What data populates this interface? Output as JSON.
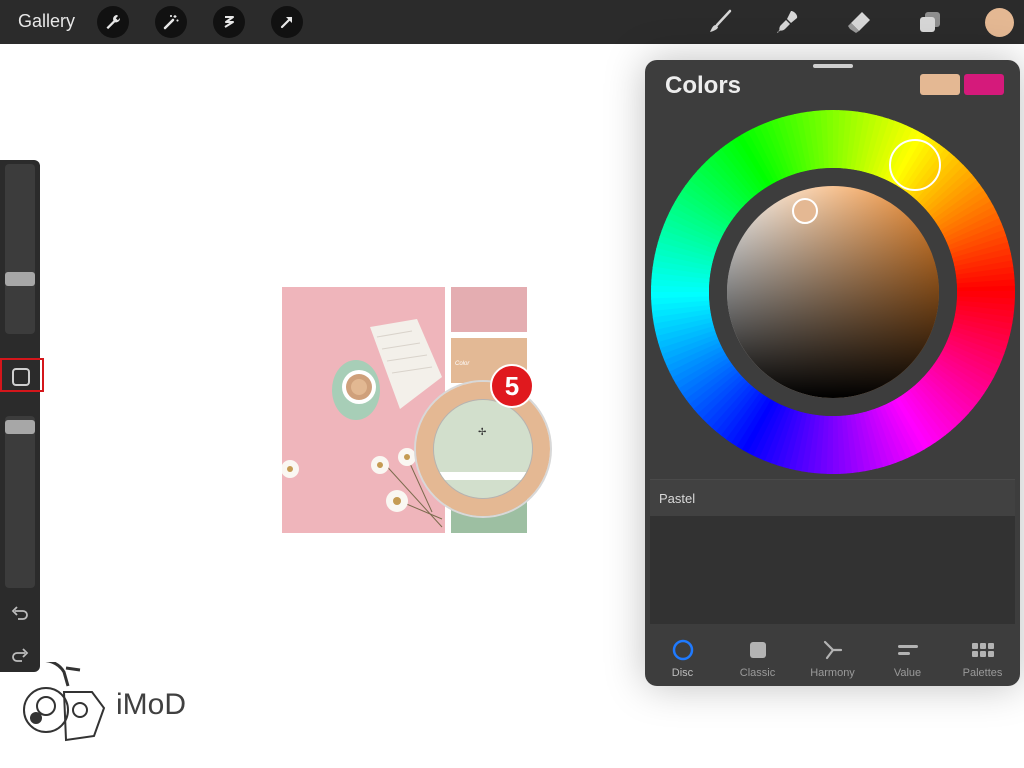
{
  "toolbar": {
    "gallery_label": "Gallery",
    "left_tools": [
      "wrench-icon",
      "magic-wand-icon",
      "selection-icon",
      "transform-arrow-icon"
    ],
    "right_tools": [
      "brush-icon",
      "smudge-icon",
      "eraser-icon",
      "layers-icon",
      "color-icon"
    ],
    "current_color": "#e4b893"
  },
  "sidebar": {
    "brush_size_thumb": 0.35,
    "opacity_thumb": 0.0,
    "modify_button": "modify-button"
  },
  "canvas": {
    "swatch_text": "Color",
    "eyedropper_color": "#e4b893",
    "step_badge": "5"
  },
  "colors_panel": {
    "title": "Colors",
    "primary_color": "#e4b893",
    "secondary_color": "#d51a7b",
    "palette_name": "Pastel",
    "tabs": [
      {
        "label": "Disc",
        "active": true
      },
      {
        "label": "Classic",
        "active": false
      },
      {
        "label": "Harmony",
        "active": false
      },
      {
        "label": "Value",
        "active": false
      },
      {
        "label": "Palettes",
        "active": false
      }
    ],
    "accent": "#1f7aff"
  },
  "watermark": {
    "text": "iMoD"
  }
}
